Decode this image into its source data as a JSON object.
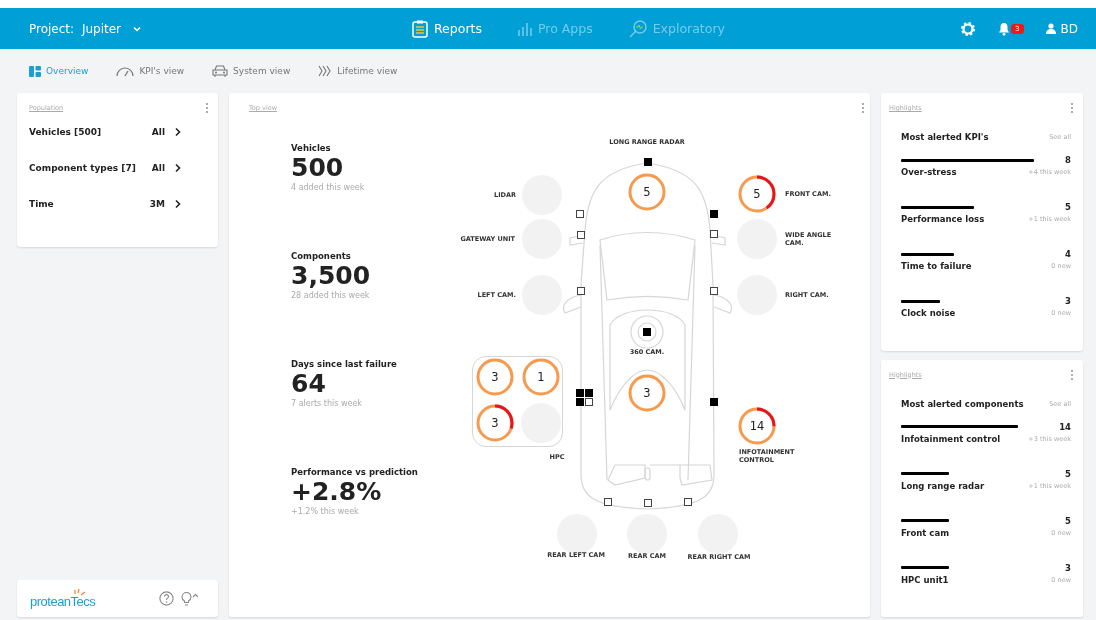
{
  "header": {
    "project_label": "Project:",
    "project": "Jupiter",
    "nav": [
      {
        "label": "Reports",
        "selected": true,
        "kind": "reports"
      },
      {
        "label": "Pro Apps",
        "selected": false,
        "kind": "apps"
      },
      {
        "label": "Exploratory",
        "selected": false,
        "kind": "explore"
      }
    ],
    "notifications": "3",
    "user": "BD"
  },
  "views": [
    {
      "label": "Overview",
      "selected": true,
      "kind": "grid"
    },
    {
      "label": "KPI's view",
      "selected": false,
      "kind": "gauge"
    },
    {
      "label": "System view",
      "selected": false,
      "kind": "car"
    },
    {
      "label": "Lifetime view",
      "selected": false,
      "kind": "chevrons"
    }
  ],
  "population": {
    "title": "Population",
    "filters": [
      {
        "label": "Vehicles [500]",
        "value": "All"
      },
      {
        "label": "Component types [7]",
        "value": "All"
      },
      {
        "label": "Time",
        "value": "3M"
      }
    ]
  },
  "footer": {
    "logo": "proteanTecs"
  },
  "top_view": {
    "title": "Top view",
    "stats": [
      {
        "label": "Vehicles",
        "value": "500",
        "note": "4 added this week"
      },
      {
        "label": "Components",
        "value": "3,500",
        "note": "28 added this week"
      },
      {
        "label": "Days since last failure",
        "value": "64",
        "note": "7 alerts this week"
      },
      {
        "label": "Performance vs prediction",
        "value": "+2.8%",
        "note": "+1.2% this week"
      }
    ],
    "sensor_labels": [
      "LONG RANGE RADAR",
      "LIDAR",
      "FRONT CAM.",
      "GATEWAY UNIT",
      "WIDE ANGLE CAM.",
      "LEFT CAM.",
      "RIGHT CAM.",
      "360 CAM.",
      "INFOTAINMENT CONTROL",
      "REAR LEFT CAM",
      "REAR CAM",
      "REAR RIGHT CAM"
    ],
    "circles": [
      {
        "kind": "empty"
      },
      {
        "kind": "gauge",
        "value": "5",
        "alert": false
      },
      {
        "kind": "gauge",
        "value": "5",
        "alert": true
      },
      {
        "kind": "empty"
      },
      {
        "kind": "empty"
      },
      {
        "kind": "empty"
      },
      {
        "kind": "empty"
      },
      {
        "kind": "camera"
      },
      {
        "kind": "gauge",
        "value": "3",
        "alert": false
      },
      {
        "kind": "gauge",
        "value": "14",
        "alert": true
      },
      {
        "kind": "empty"
      },
      {
        "kind": "empty"
      },
      {
        "kind": "empty"
      }
    ],
    "hpc": {
      "label": "HPC",
      "units": [
        {
          "kind": "gauge",
          "value": "3",
          "alert": false
        },
        {
          "kind": "gauge",
          "value": "1",
          "alert": false
        },
        {
          "kind": "gauge",
          "value": "3",
          "alert": true
        },
        {
          "kind": "empty"
        }
      ]
    },
    "markers": [
      {
        "filled": true
      },
      {
        "filled": false
      },
      {
        "filled": true
      },
      {
        "filled": false
      },
      {
        "filled": false
      },
      {
        "filled": false
      },
      {
        "filled": false
      },
      {
        "filled": true
      },
      {
        "filled": true
      },
      {
        "filled": true
      },
      {
        "filled": false
      },
      {
        "filled": true
      },
      {
        "filled": false
      },
      {
        "filled": false
      },
      {
        "filled": false
      }
    ]
  },
  "highlights": [
    {
      "title": "Highlights",
      "heading": "Most alerted KPI's",
      "see_all": "See all",
      "items": [
        {
          "name": "Over-stress",
          "count": "8",
          "note": "+4 this week"
        },
        {
          "name": "Performance loss",
          "count": "5",
          "note": "+1 this week"
        },
        {
          "name": "Time to failure",
          "count": "4",
          "note": "0 new"
        },
        {
          "name": "Clock noise",
          "count": "3",
          "note": "0 new"
        }
      ]
    },
    {
      "title": "Highlights",
      "heading": "Most alerted components",
      "see_all": "See all",
      "items": [
        {
          "name": "Infotainment control",
          "count": "14",
          "note": "+3 this week"
        },
        {
          "name": "Long range radar",
          "count": "5",
          "note": "+1 this week"
        },
        {
          "name": "Front cam",
          "count": "5",
          "note": "0 new"
        },
        {
          "name": "HPC unit1",
          "count": "3",
          "note": "0 new"
        }
      ]
    }
  ]
}
